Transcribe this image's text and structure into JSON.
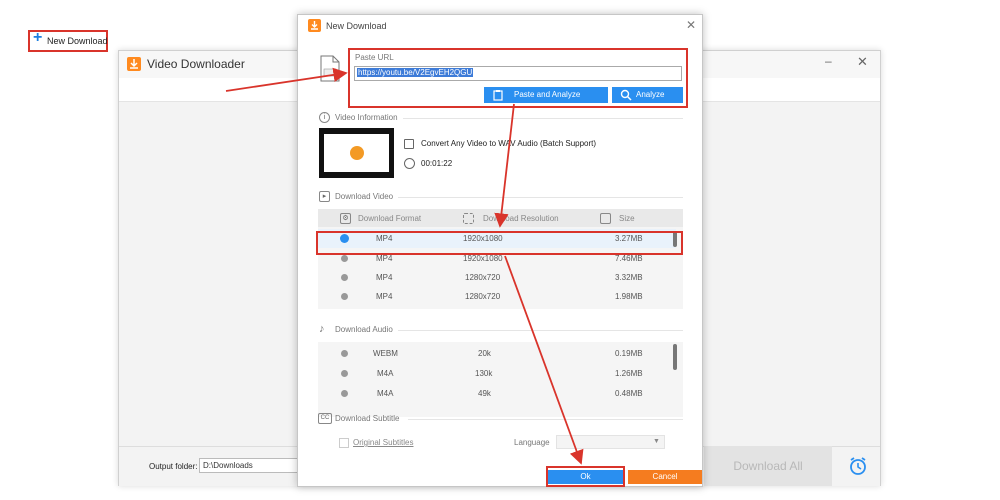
{
  "main_window": {
    "title": "Video Downloader",
    "minimize_icon": "minimize-icon",
    "close_icon": "close-icon",
    "new_download_label": "New Download",
    "output_folder_label": "Output folder:",
    "output_folder_value": "D:\\Downloads",
    "download_all_label": "Download All"
  },
  "dialog": {
    "title": "New Download",
    "paste_url_label": "Paste URL",
    "url_value": "https://youtu.be/V2EgvEH2QGU",
    "paste_analyze_label": "Paste and Analyze",
    "analyze_label": "Analyze",
    "video_info_label": "Video Information",
    "video_title": "Convert Any Video to WAV Audio (Batch Support)",
    "video_duration": "00:01:22",
    "download_video_label": "Download Video",
    "video_columns": [
      "Download Format",
      "Download Resolution",
      "Size"
    ],
    "video_rows": [
      {
        "format": "MP4",
        "resolution": "1920x1080",
        "size": "3.27MB",
        "selected": true
      },
      {
        "format": "MP4",
        "resolution": "1920x1080",
        "size": "7.46MB",
        "selected": false
      },
      {
        "format": "MP4",
        "resolution": "1280x720",
        "size": "3.32MB",
        "selected": false
      },
      {
        "format": "MP4",
        "resolution": "1280x720",
        "size": "1.98MB",
        "selected": false
      }
    ],
    "download_audio_label": "Download Audio",
    "audio_rows": [
      {
        "format": "WEBM",
        "bitrate": "20k",
        "size": "0.19MB"
      },
      {
        "format": "M4A",
        "bitrate": "130k",
        "size": "1.26MB"
      },
      {
        "format": "M4A",
        "bitrate": "49k",
        "size": "0.48MB"
      }
    ],
    "download_subtitle_label": "Download Subtitle",
    "subtitle_cc": "CC",
    "original_subtitles_label": "Original Subtitles",
    "language_label": "Language",
    "ok_label": "Ok",
    "cancel_label": "Cancel"
  },
  "colors": {
    "accent_blue": "#2a8ff0",
    "highlight_red": "#d9342b",
    "cancel_orange": "#f57c1f",
    "logo_orange": "#ff8a1f"
  }
}
